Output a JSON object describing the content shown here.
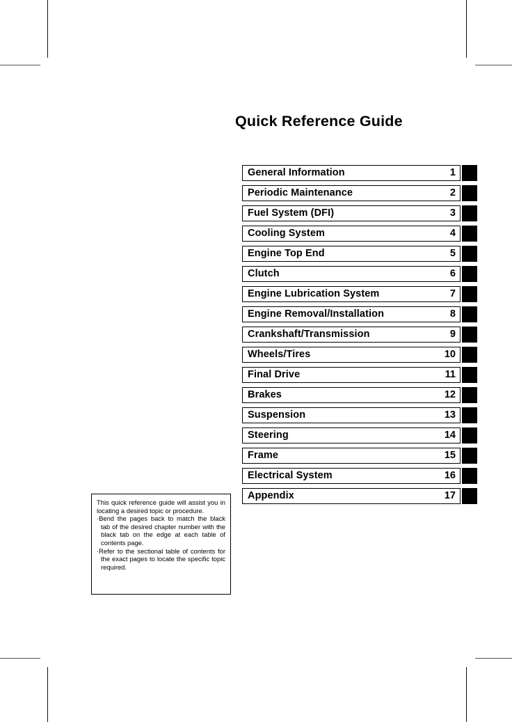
{
  "document": {
    "title": "Quick Reference Guide",
    "background_color": "#ffffff",
    "text_color": "#000000",
    "tab_color": "#000000"
  },
  "chapters": [
    {
      "name": "General Information",
      "number": "1"
    },
    {
      "name": "Periodic Maintenance",
      "number": "2"
    },
    {
      "name": "Fuel System (DFI)",
      "number": "3"
    },
    {
      "name": "Cooling System",
      "number": "4"
    },
    {
      "name": "Engine Top End",
      "number": "5"
    },
    {
      "name": "Clutch",
      "number": "6"
    },
    {
      "name": "Engine Lubrication System",
      "number": "7"
    },
    {
      "name": "Engine Removal/Installation",
      "number": "8"
    },
    {
      "name": "Crankshaft/Transmission",
      "number": "9"
    },
    {
      "name": "Wheels/Tires",
      "number": "10"
    },
    {
      "name": "Final Drive",
      "number": "11"
    },
    {
      "name": "Brakes",
      "number": "12"
    },
    {
      "name": "Suspension",
      "number": "13"
    },
    {
      "name": "Steering",
      "number": "14"
    },
    {
      "name": "Frame",
      "number": "15"
    },
    {
      "name": "Electrical System",
      "number": "16"
    },
    {
      "name": "Appendix",
      "number": "17"
    }
  ],
  "note": {
    "intro": "This quick reference guide will assist you in locating a desired topic or procedure.",
    "bullets": [
      "Bend the pages back to match the black tab of the desired chapter number with the black tab on the edge at each table of contents page.",
      "Refer to the sectional table of contents for the exact pages to locate the specific topic required."
    ],
    "bullet_marker": "·"
  },
  "crop_marks": {
    "top_left": "crop-mark-top-left",
    "top_right": "crop-mark-top-right",
    "bottom_left": "crop-mark-bottom-left",
    "bottom_right": "crop-mark-bottom-right"
  }
}
